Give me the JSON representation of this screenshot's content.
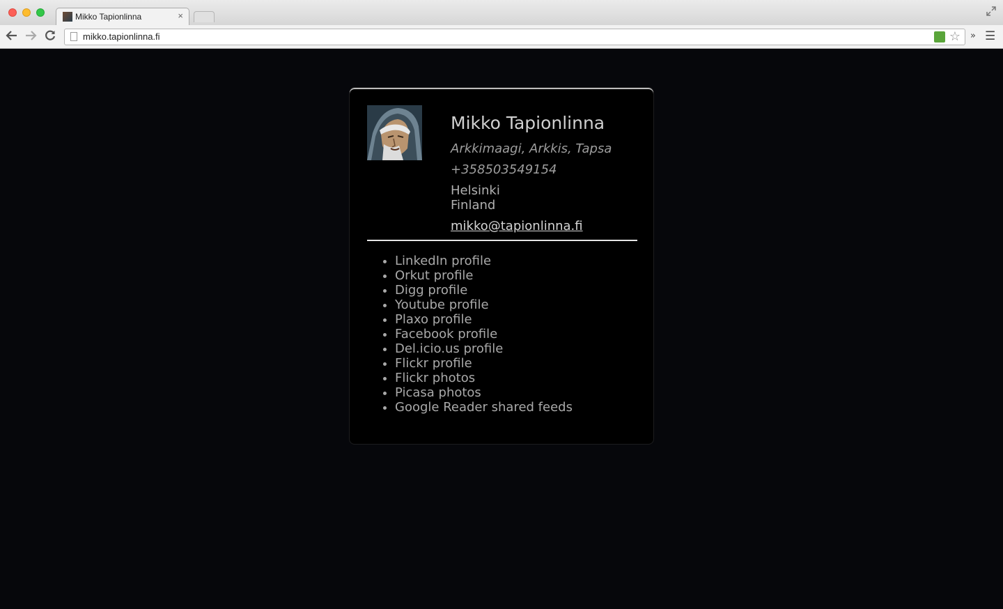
{
  "browser": {
    "tab_title": "Mikko Tapionlinna",
    "tab_close": "×",
    "url": "mikko.tapionlinna.fi",
    "icons": {
      "back": "arrow-left",
      "forward": "arrow-right",
      "reload": "reload",
      "star": "star",
      "menu": "hamburger",
      "extensions": "chevron-double-right",
      "fullscreen": "expand"
    }
  },
  "card": {
    "name": "Mikko Tapionlinna",
    "nickname": "Arkkimaagi, Arkkis, Tapsa",
    "phone": "+358503549154",
    "city": "Helsinki",
    "country": "Finland",
    "email": "mikko@tapionlinna.fi",
    "links": [
      "LinkedIn profile",
      "Orkut profile",
      "Digg profile",
      "Youtube profile",
      "Plaxo profile",
      "Facebook profile",
      "Del.icio.us profile",
      "Flickr profile",
      "Flickr photos",
      "Picasa photos",
      "Google Reader shared feeds"
    ]
  },
  "colors": {
    "page_background": "#06070b",
    "card_background": "#000000",
    "text_primary": "#d0d0d0",
    "text_secondary": "#9e9e9e"
  }
}
